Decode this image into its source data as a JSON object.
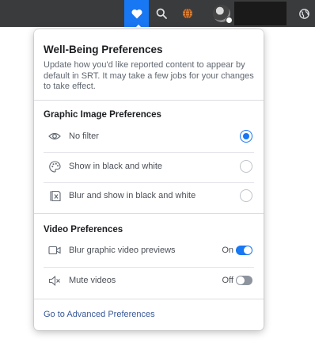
{
  "topbar": {
    "icons": {
      "heart": "heart-icon",
      "search": "search-icon",
      "globe": "globe-icon",
      "world": "world-icon"
    },
    "accent": "#1877f2"
  },
  "panel": {
    "title": "Well-Being Preferences",
    "description": "Update how you'd like reported content to appear by default in SRT. It may take a few jobs for your changes to take effect.",
    "graphic": {
      "title": "Graphic Image Preferences",
      "options": [
        {
          "label": "No filter",
          "icon": "eye-icon",
          "selected": true
        },
        {
          "label": "Show in black and white",
          "icon": "palette-icon",
          "selected": false
        },
        {
          "label": "Blur and show in black and white",
          "icon": "blur-image-icon",
          "selected": false
        }
      ]
    },
    "video": {
      "title": "Video Preferences",
      "options": [
        {
          "label": "Blur graphic video previews",
          "icon": "video-camera-icon",
          "state": "On"
        },
        {
          "label": "Mute videos",
          "icon": "mute-speaker-icon",
          "state": "Off"
        }
      ]
    },
    "link": "Go to Advanced Preferences"
  }
}
